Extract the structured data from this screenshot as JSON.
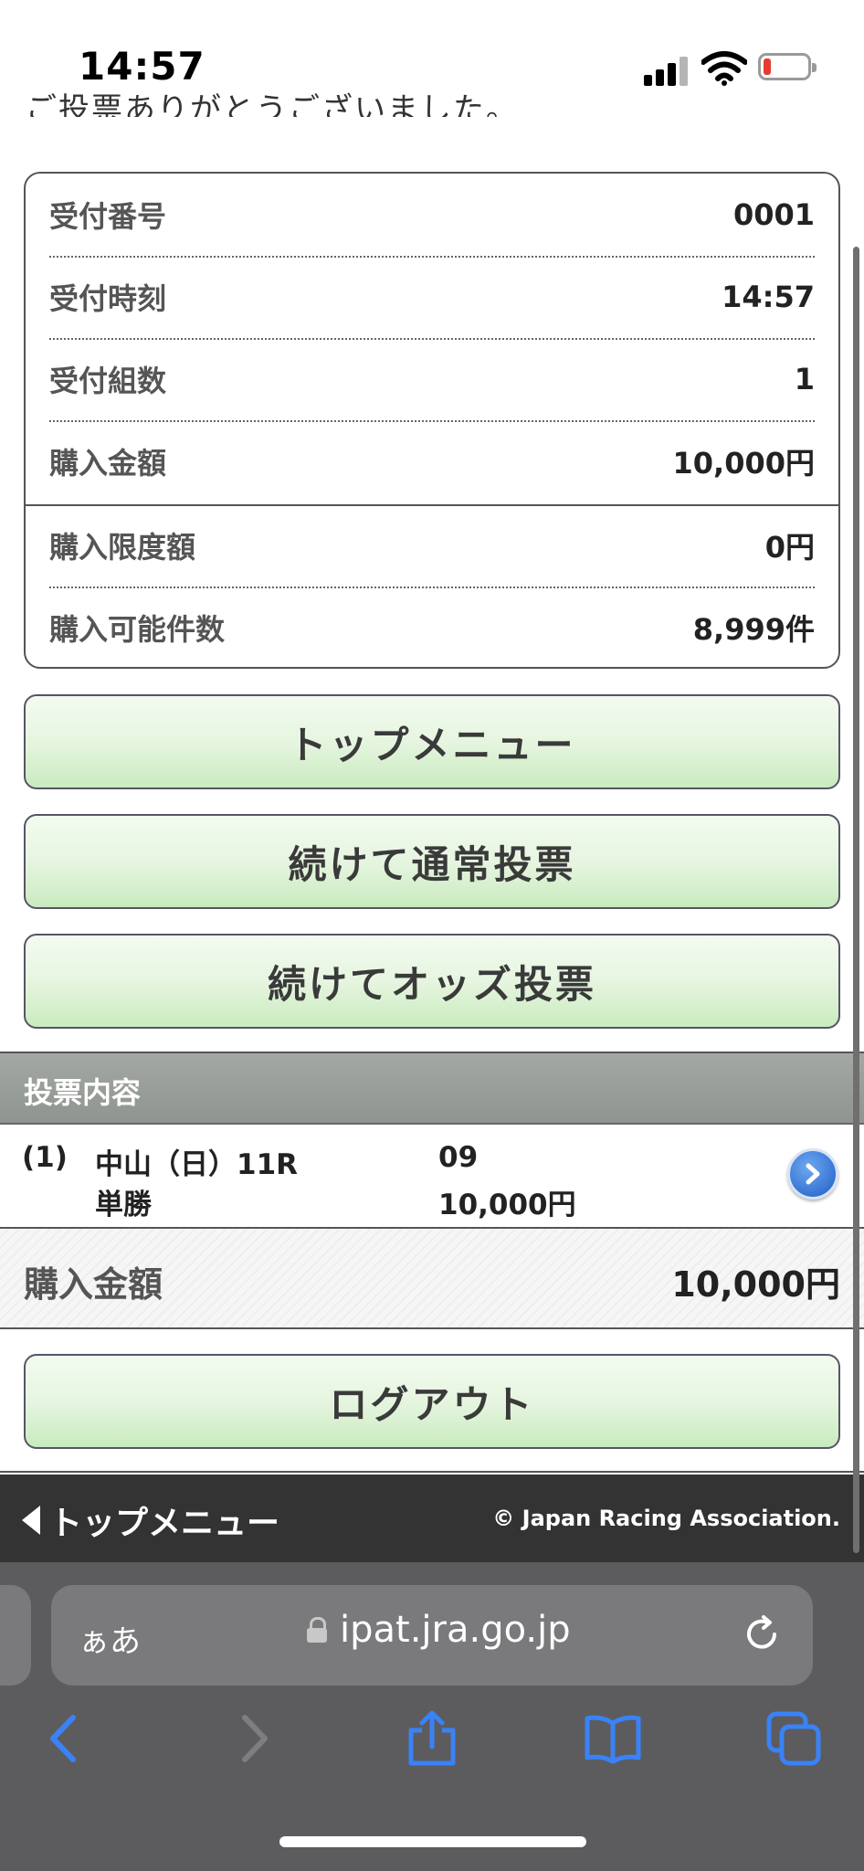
{
  "status_bar": {
    "time": "14:57"
  },
  "partial_message": "ご投票ありがとうございました。",
  "receipt": {
    "rows": [
      {
        "label": "受付番号",
        "value": "0001"
      },
      {
        "label": "受付時刻",
        "value": "14:57"
      },
      {
        "label": "受付組数",
        "value": "1"
      },
      {
        "label": "購入金額",
        "value": "10,000円"
      },
      {
        "label": "購入限度額",
        "value": "0円"
      },
      {
        "label": "購入可能件数",
        "value": "8,999件"
      }
    ]
  },
  "buttons": {
    "top_menu": "トップメニュー",
    "continue_normal": "続けて通常投票",
    "continue_odds": "続けてオッズ投票",
    "logout": "ログアウト"
  },
  "bet_section": {
    "header": "投票内容",
    "item": {
      "number": "(1)",
      "venue": "中山（日）11R",
      "type": "単勝",
      "horse": "09",
      "amount": "10,000円"
    }
  },
  "total": {
    "label": "購入金額",
    "value": "10,000円"
  },
  "footer": {
    "back_label": "トップメニュー",
    "copyright": "© Japan Racing Association."
  },
  "browser": {
    "aa_label": "ぁあ",
    "url": "ipat.jra.go.jp",
    "accent_color": "#3a82f7"
  }
}
